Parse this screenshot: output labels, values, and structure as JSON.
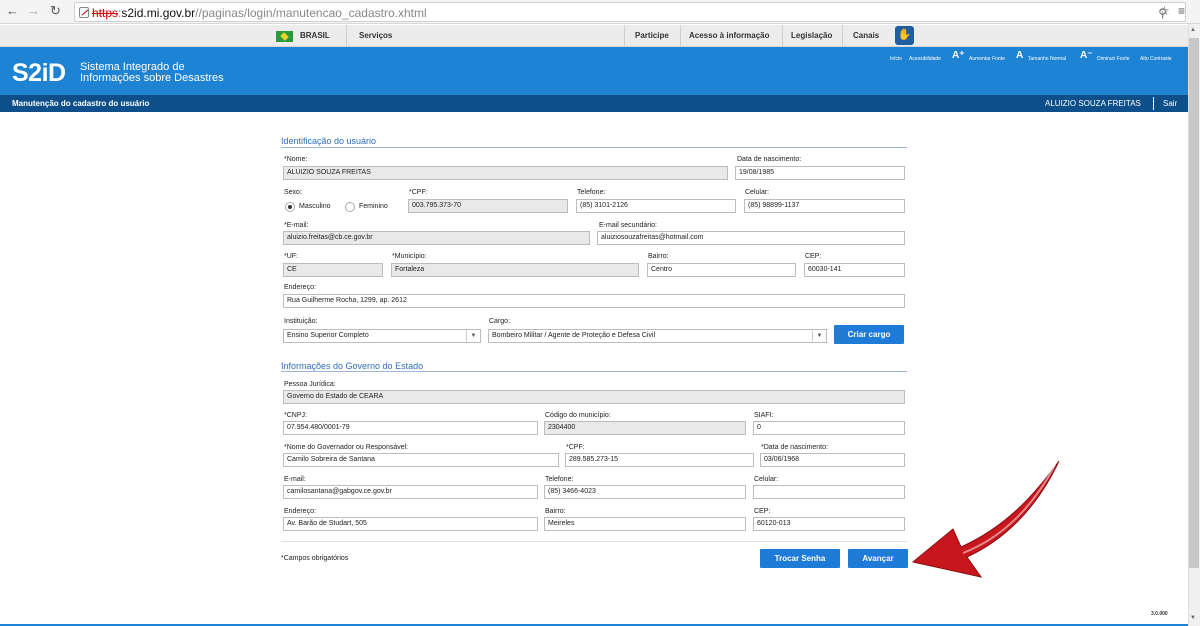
{
  "browser": {
    "url_scheme": "https",
    "url_host": "s2id.mi.gov.br",
    "url_path": "//paginas/login/manutencao_cadastro.xhtml"
  },
  "gov_bar": {
    "brasil": "BRASIL",
    "servicos": "Serviços",
    "participe": "Participe",
    "acesso": "Acesso à informação",
    "legislacao": "Legislação",
    "canais": "Canais"
  },
  "header": {
    "logo": "S2iD",
    "subtitle_1": "Sistema Integrado de",
    "subtitle_2": "Informações sobre Desastres",
    "links": {
      "inicio": "Início",
      "acessibilidade": "Acessibilidade",
      "aumentar": "Aumentar Fonte",
      "normal": "Tamanho Normal",
      "diminuir": "Diminuir Fonte",
      "contraste": "Alto Contraste"
    }
  },
  "title_bar": {
    "title": "Manutenção do cadastro do usuário",
    "user": "ALUIZIO SOUZA FREITAS",
    "logout": "Sair"
  },
  "user": {
    "section": "Identificação do usuário",
    "nome_label": "*Nome:",
    "nome": "ALUIZIO SOUZA FREITAS",
    "nasc_label": "Data de nascimento:",
    "nasc": "19/08/1985",
    "sexo_label": "Sexo:",
    "sexo_m": "Masculino",
    "sexo_f": "Feminino",
    "cpf_label": "*CPF:",
    "cpf": "003.795.373-70",
    "telefone_label": "Telefone:",
    "telefone": "(85) 3101-2126",
    "celular_label": "Celular:",
    "celular": "(85) 98899-1137",
    "email_label": "*E-mail:",
    "email": "aluizio.freitas@cb.ce.gov.br",
    "email2_label": "E-mail secundário:",
    "email2": "aluiziosouzafreitas@hotmail.com",
    "uf_label": "*UF:",
    "uf": "CE",
    "municipio_label": "*Município:",
    "municipio": "Fortaleza",
    "bairro_label": "Bairro:",
    "bairro": "Centro",
    "cep_label": "CEP:",
    "cep": "60030-141",
    "endereco_label": "Endereço:",
    "endereco": "Rua Guilherme Rocha, 1299, ap. 2612",
    "instituicao_label": "Instituição:",
    "instituicao": "Ensino Superior Completo",
    "cargo_label": "Cargo:",
    "cargo": "Bombeiro Militar / Agente de Proteção e Defesa Civil",
    "criar_cargo": "Criar cargo"
  },
  "gov": {
    "section": "Informações do Governo do Estado",
    "pj_label": "Pessoa Jurídica:",
    "pj": "Governo do Estado de CEARA",
    "cnpj_label": "*CNPJ:",
    "cnpj": "07.954.480/0001-79",
    "codmun_label": "Código do município:",
    "codmun": "2304400",
    "siafi_label": "SIAFI:",
    "siafi": "0",
    "resp_label": "*Nome do Governador ou Responsável:",
    "resp": "Camilo Sobreira de Santana",
    "cpf_label": "*CPF:",
    "cpf": "289.585.273-15",
    "nasc_label": "*Data de nascimento:",
    "nasc": "03/06/1968",
    "email_label": "E-mail:",
    "email": "camilosantana@gabgov.ce.gov.br",
    "telefone_label": "Telefone:",
    "telefone": "(85) 3466-4023",
    "celular_label": "Celular:",
    "celular": "",
    "endereco_label": "Endereço:",
    "endereco": "Av. Barão de Studart, 505",
    "bairro_label": "Bairro:",
    "bairro": "Meireles",
    "cep_label": "CEP:",
    "cep": "60120-013"
  },
  "footer": {
    "required": "*Campos obrigatórios",
    "trocar_senha": "Trocar Senha",
    "avancar": "Avançar",
    "version": "3.0.000"
  },
  "colors": {
    "header": "#1f83d3",
    "title_bar": "#0c4f8b",
    "button": "#1f7bd8",
    "arrow": "#c8161d"
  }
}
